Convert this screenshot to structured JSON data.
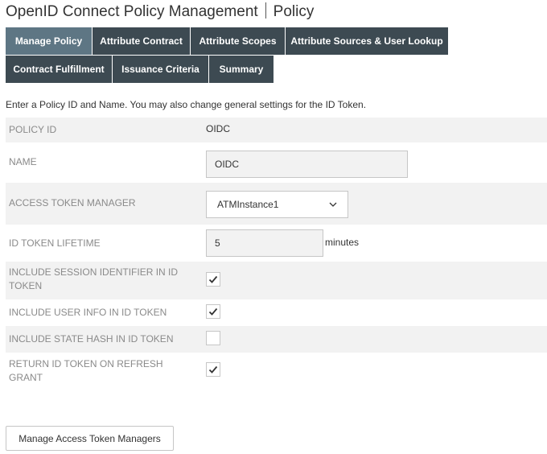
{
  "header": {
    "title_main": "OpenID Connect Policy Management",
    "title_sub": "Policy"
  },
  "tabs": {
    "row1": [
      {
        "label": "Manage Policy",
        "active": true
      },
      {
        "label": "Attribute Contract",
        "active": false
      },
      {
        "label": "Attribute Scopes",
        "active": false
      },
      {
        "label": "Attribute Sources & User Lookup",
        "active": false
      }
    ],
    "row2": [
      {
        "label": "Contract Fulfillment",
        "active": false
      },
      {
        "label": "Issuance Criteria",
        "active": false
      },
      {
        "label": "Summary",
        "active": false
      }
    ]
  },
  "intro": "Enter a Policy ID and Name. You may also change general settings for the ID Token.",
  "form": {
    "policy_id": {
      "label": "Policy ID",
      "value": "OIDC"
    },
    "name": {
      "label": "Name",
      "value": "OIDC"
    },
    "access_token_manager": {
      "label": "Access Token Manager",
      "value": "ATMInstance1"
    },
    "id_token_lifetime": {
      "label": "ID Token Lifetime",
      "value": "5",
      "unit": "minutes"
    },
    "include_session_identifier": {
      "label": "Include Session Identifier in ID Token",
      "checked": true
    },
    "include_user_info": {
      "label": "Include User Info in ID Token",
      "checked": true
    },
    "include_state_hash": {
      "label": "Include State Hash in ID Token",
      "checked": false
    },
    "return_id_token_on_refresh": {
      "label": "Return ID Token on Refresh Grant",
      "checked": true
    }
  },
  "buttons": {
    "manage_atm": "Manage Access Token Managers"
  },
  "icons": {
    "dropdown": "chevron-down-icon",
    "check": "checkmark-icon"
  },
  "colors": {
    "tab_bg": "#3d4a52",
    "tab_active_bg": "#5e7684",
    "row_shade": "#f2f2f2"
  }
}
